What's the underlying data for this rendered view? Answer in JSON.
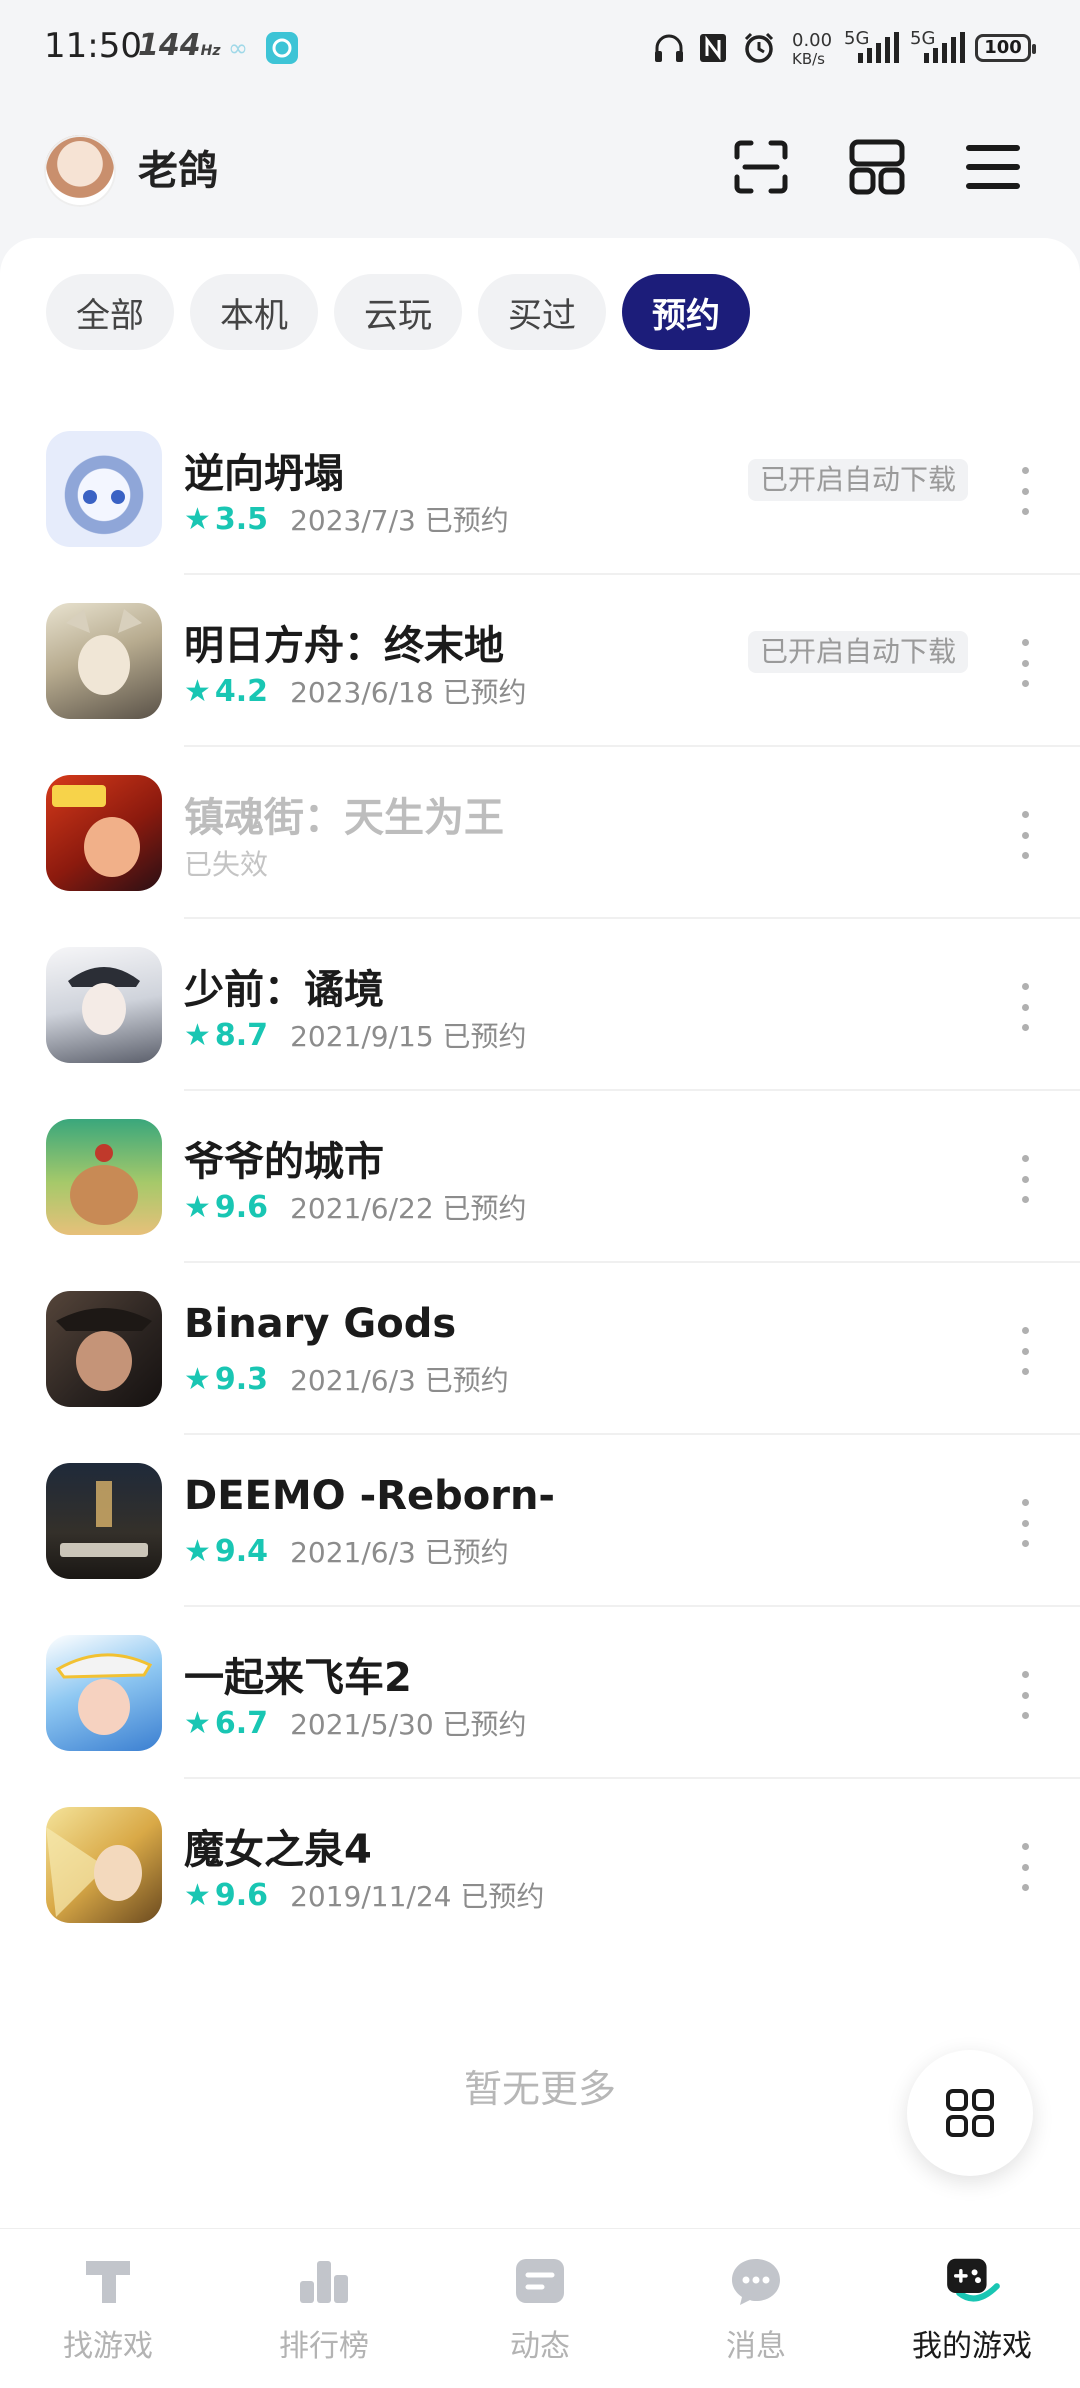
{
  "status_bar": {
    "time": "11:50",
    "refresh_rate": "144",
    "refresh_unit": "Hz",
    "net_speed_value": "0.00",
    "net_speed_unit": "KB/s",
    "signal1_label": "5G",
    "signal2_label": "5G",
    "battery": "100"
  },
  "header": {
    "username": "老鸽",
    "scan_icon": "scan-icon",
    "layout_icon": "grid-layout-icon",
    "menu_icon": "hamburger-menu-icon"
  },
  "filters": [
    {
      "label": "全部",
      "active": false
    },
    {
      "label": "本机",
      "active": false
    },
    {
      "label": "云玩",
      "active": false
    },
    {
      "label": "买过",
      "active": false
    },
    {
      "label": "预约",
      "active": true
    }
  ],
  "games": [
    {
      "title": "逆向坍塌",
      "rating": "3.5",
      "status": "2023/7/3 已预约",
      "tag": "已开启自动下载",
      "invalid": false
    },
    {
      "title": "明日方舟：终末地",
      "rating": "4.2",
      "status": "2023/6/18 已预约",
      "tag": "已开启自动下载",
      "invalid": false
    },
    {
      "title": "镇魂街：天生为王",
      "rating": "",
      "status": "已失效",
      "tag": "",
      "invalid": true
    },
    {
      "title": "少前：谲境",
      "rating": "8.7",
      "status": "2021/9/15 已预约",
      "tag": "",
      "invalid": false
    },
    {
      "title": "爷爷的城市",
      "rating": "9.6",
      "status": "2021/6/22 已预约",
      "tag": "",
      "invalid": false
    },
    {
      "title": "Binary Gods",
      "rating": "9.3",
      "status": "2021/6/3 已预约",
      "tag": "",
      "invalid": false
    },
    {
      "title": "DEEMO -Reborn-",
      "rating": "9.4",
      "status": "2021/6/3 已预约",
      "tag": "",
      "invalid": false
    },
    {
      "title": "一起来飞车2",
      "rating": "6.7",
      "status": "2021/5/30 已预约",
      "tag": "",
      "invalid": false
    },
    {
      "title": "魔女之泉4",
      "rating": "9.6",
      "status": "2019/11/24 已预约",
      "tag": "",
      "invalid": false
    }
  ],
  "list_end_text": "暂无更多",
  "bottom_nav": [
    {
      "label": "找游戏",
      "icon": "find-game-icon",
      "active": false
    },
    {
      "label": "排行榜",
      "icon": "ranking-icon",
      "active": false
    },
    {
      "label": "动态",
      "icon": "feed-icon",
      "active": false
    },
    {
      "label": "消息",
      "icon": "message-icon",
      "active": false
    },
    {
      "label": "我的游戏",
      "icon": "my-games-icon",
      "active": true
    }
  ],
  "colors": {
    "accent": "#1c1d7a",
    "rating": "#19c6b3",
    "page_bg": "#f4f5f7"
  }
}
